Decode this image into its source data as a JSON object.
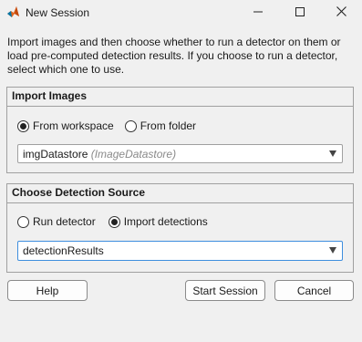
{
  "window": {
    "title": "New Session",
    "icon": "matlab-icon",
    "controls": [
      "minimize-icon",
      "maximize-icon",
      "close-icon"
    ]
  },
  "intro_text": "Import images and then choose whether to run a detector on them or load pre-computed detection results. If you choose to run a detector, select which one to use.",
  "import_images": {
    "heading": "Import Images",
    "options": [
      {
        "label": "From workspace",
        "selected": true
      },
      {
        "label": "From folder",
        "selected": false
      }
    ],
    "dropdown": {
      "value": "imgDatastore",
      "type_hint": "(ImageDatastore)"
    }
  },
  "detection_source": {
    "heading": "Choose Detection Source",
    "options": [
      {
        "label": "Run detector",
        "selected": false
      },
      {
        "label": "Import detections",
        "selected": true
      }
    ],
    "dropdown": {
      "value": "detectionResults"
    }
  },
  "buttons": {
    "help": "Help",
    "start": "Start Session",
    "cancel": "Cancel"
  },
  "colors": {
    "background": "#f0f0f0",
    "focus_border": "#3e8ede"
  }
}
